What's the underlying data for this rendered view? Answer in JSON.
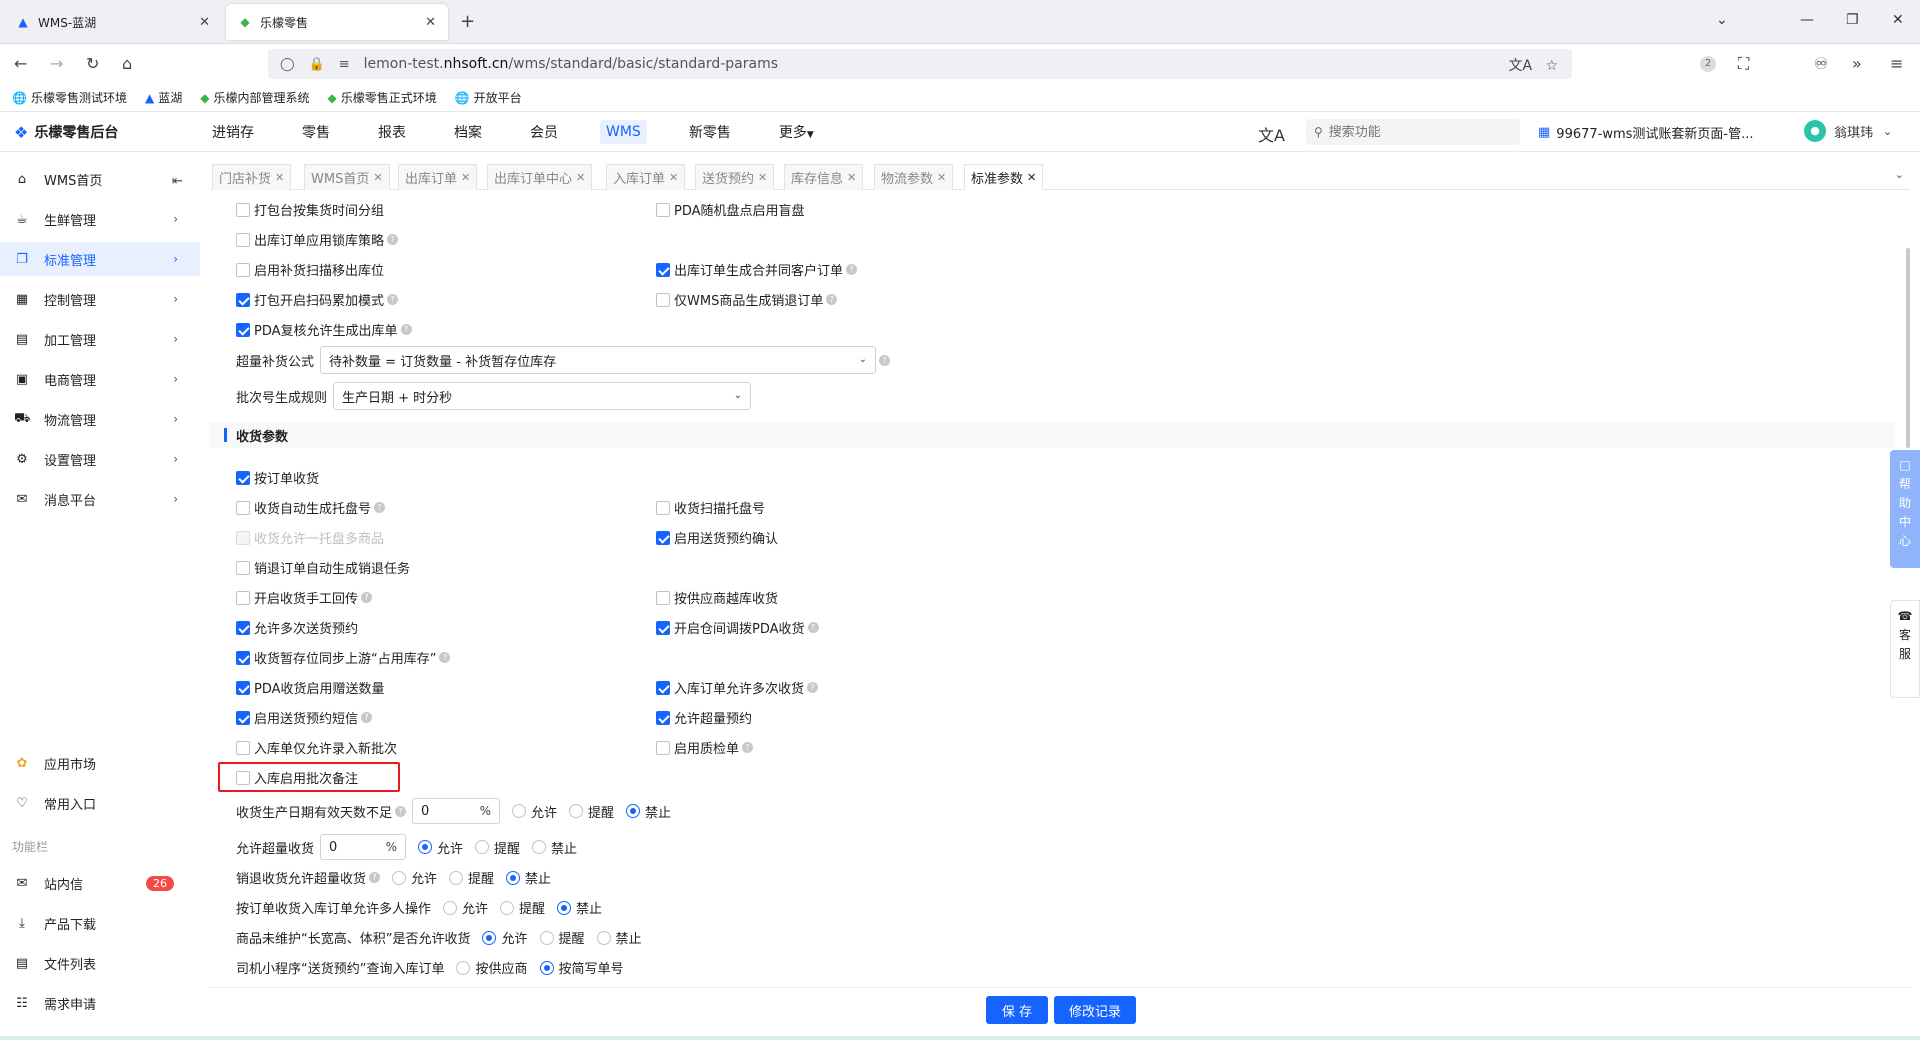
{
  "browser": {
    "tabs": [
      {
        "label": "WMS-蓝湖"
      },
      {
        "label": "乐檬零售"
      }
    ],
    "url_prefix": "lemon-test.",
    "url_host": "nhsoft.cn",
    "url_path": "/wms/standard/basic/standard-params",
    "ext_badge": "2",
    "bookmarks": [
      {
        "label": "乐檬零售测试环境"
      },
      {
        "label": "蓝湖"
      },
      {
        "label": "乐檬内部管理系统"
      },
      {
        "label": "乐檬零售正式环境"
      },
      {
        "label": "开放平台"
      }
    ]
  },
  "app": {
    "logo": "乐檬零售后台",
    "topnav": [
      {
        "label": "进销存"
      },
      {
        "label": "零售"
      },
      {
        "label": "报表"
      },
      {
        "label": "档案"
      },
      {
        "label": "会员"
      },
      {
        "label": "WMS"
      },
      {
        "label": "新零售"
      },
      {
        "label": "更多"
      }
    ],
    "search_placeholder": "搜索功能",
    "account": "99677-wms测试账套新页面-管...",
    "user": "翁琪玮"
  },
  "sidebar": {
    "items": [
      {
        "label": "WMS首页"
      },
      {
        "label": "生鲜管理"
      },
      {
        "label": "标准管理"
      },
      {
        "label": "控制管理"
      },
      {
        "label": "加工管理"
      },
      {
        "label": "电商管理"
      },
      {
        "label": "物流管理"
      },
      {
        "label": "设置管理"
      },
      {
        "label": "消息平台"
      }
    ],
    "bottom": [
      {
        "label": "应用市场"
      },
      {
        "label": "常用入口"
      }
    ],
    "section_label": "功能栏",
    "tools": [
      {
        "label": "站内信",
        "badge": "26"
      },
      {
        "label": "产品下载"
      },
      {
        "label": "文件列表"
      },
      {
        "label": "需求申请"
      }
    ]
  },
  "pagetabs": [
    {
      "label": "门店补货"
    },
    {
      "label": "WMS首页"
    },
    {
      "label": "出库订单"
    },
    {
      "label": "出库订单中心"
    },
    {
      "label": "入库订单"
    },
    {
      "label": "送货预约"
    },
    {
      "label": "库存信息"
    },
    {
      "label": "物流参数"
    },
    {
      "label": "标准参数"
    }
  ],
  "params": {
    "c1": "打包台按集货时间分组",
    "c2": "PDA随机盘点启用盲盘",
    "c3": "出库订单应用锁库策略",
    "c4": "启用补货扫描移出库位",
    "c5": "出库订单生成合并同客户订单",
    "c6": "打包开启扫码累加模式",
    "c7": "仅WMS商品生成销退订单",
    "c8": "PDA复核允许生成出库单",
    "f1_label": "超量补货公式",
    "f1_value": "待补数量 = 订货数量 - 补货暂存位库存",
    "f2_label": "批次号生成规则",
    "f2_value": "生产日期 + 时分秒"
  },
  "receive": {
    "section_title": "收货参数",
    "r1": "按订单收货",
    "r2": "收货自动生成托盘号",
    "r3": "收货扫描托盘号",
    "r4": "收货允许一托盘多商品",
    "r5": "启用送货预约确认",
    "r6": "销退订单自动生成销退任务",
    "r7": "开启收货手工回传",
    "r8": "按供应商越库收货",
    "r9": "允许多次送货预约",
    "r10": "开启仓间调拨PDA收货",
    "r11": "收货暂存位同步上游“占用库存”",
    "r12": "PDA收货启用赠送数量",
    "r13": "入库订单允许多次收货",
    "r14": "启用送货预约短信",
    "r15": "允许超量预约",
    "r16": "入库单仅允许录入新批次",
    "r17": "启用质检单",
    "r18": "入库启用批次备注",
    "q1_label": "收货生产日期有效天数不足",
    "q1_value": "0",
    "q2_label": "允许超量收货",
    "q2_value": "0",
    "q3_label": "销退收货允许超量收货",
    "q4_label": "按订单收货入库订单允许多人操作",
    "q5_label": "商品未维护“长宽高、体积”是否允许收货",
    "q6_label": "司机小程序“送货预约”查询入库订单",
    "pct": "%",
    "allow": "允许",
    "remind": "提醒",
    "forbid": "禁止",
    "by_supplier": "按供应商",
    "by_short": "按简写单号"
  },
  "footer": {
    "save": "保 存",
    "history": "修改记录"
  },
  "float": {
    "help": [
      "帮",
      "助",
      "中",
      "心"
    ],
    "cs": [
      "客",
      "服"
    ]
  }
}
